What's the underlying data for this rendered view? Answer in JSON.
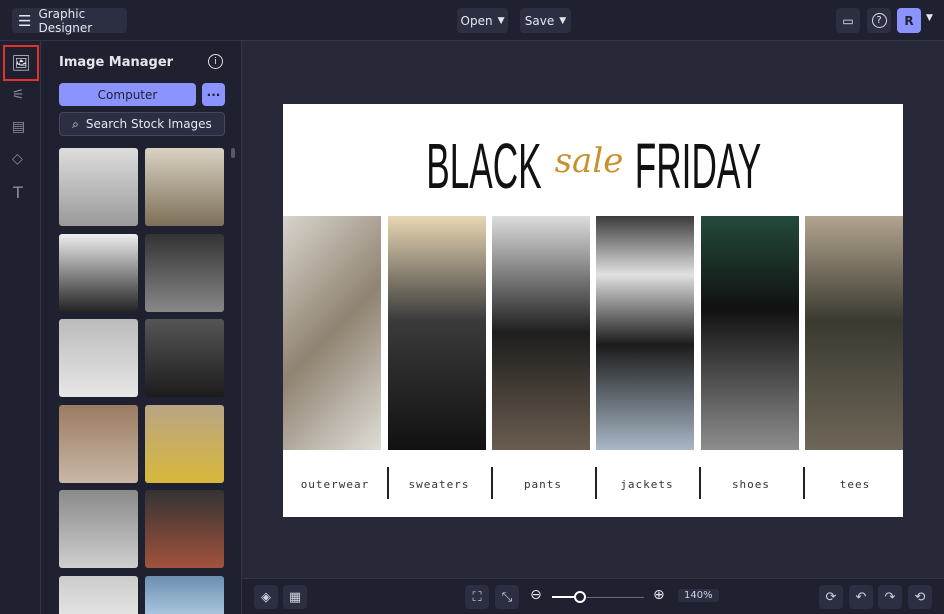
{
  "header": {
    "app_title": "Graphic Designer",
    "open_label": "Open",
    "save_label": "Save",
    "avatar_initial": "R"
  },
  "panel": {
    "title": "Image Manager",
    "computer_label": "Computer",
    "more_label": "···",
    "search_label": "Search Stock Images"
  },
  "design": {
    "title_left": "BLACK",
    "title_script": "sale",
    "title_right": "FRIDAY",
    "script_color": "#c8912e",
    "categories": [
      "outerwear",
      "sweaters",
      "pants",
      "jackets",
      "shoes",
      "tees"
    ]
  },
  "zoom": {
    "level": "140%",
    "fraction": 0.14
  },
  "colors": {
    "accent": "#8b93ff",
    "highlight": "#e0342b"
  }
}
